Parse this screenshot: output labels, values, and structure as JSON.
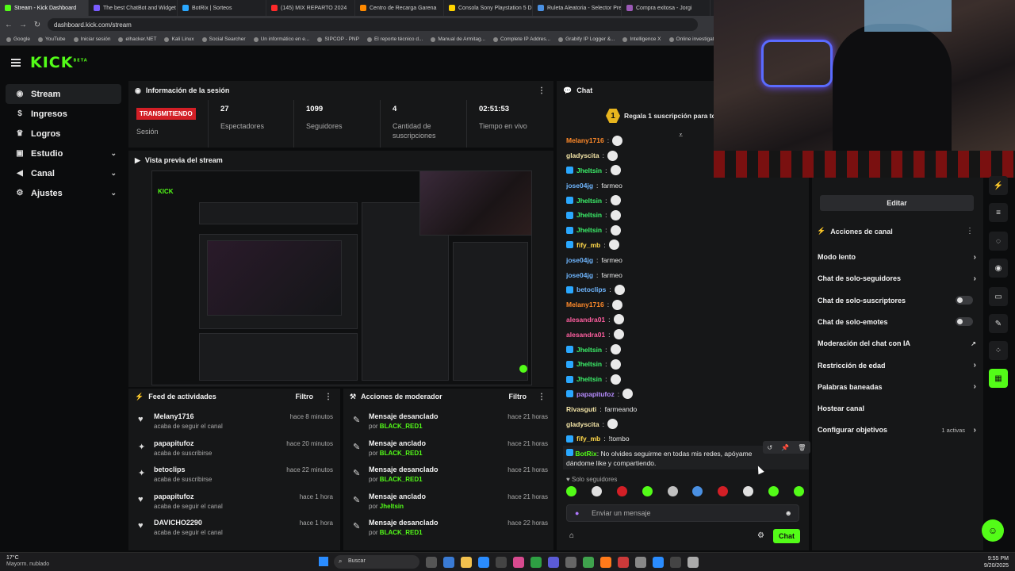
{
  "browser": {
    "tabs": [
      {
        "label": "Stream - Kick Dashboard",
        "color": "#53fc18",
        "active": true
      },
      {
        "label": "The best ChatBot and Widget",
        "color": "#7a5cff"
      },
      {
        "label": "BotRix | Sorteos",
        "color": "#2aa8ff"
      },
      {
        "label": "(145) MIX REPARTO 2024",
        "color": "#ff2a2a"
      },
      {
        "label": "Centro de Recarga Garena",
        "color": "#ff8a00"
      },
      {
        "label": "Consola Sony Playstation 5 D",
        "color": "#ffd400"
      },
      {
        "label": "Ruleta Aleatoria - Selector Pre",
        "color": "#4a90e2"
      },
      {
        "label": "Compra exitosa - Jorgi",
        "color": "#9b59b6"
      }
    ],
    "url": "dashboard.kick.com/stream",
    "bookmarks": [
      "Google",
      "YouTube",
      "Iniciar sesión",
      "elhacker.NET",
      "Kali Linux",
      "Social Searcher",
      "Un informático en e...",
      "SIPCOP - PNP",
      "El reporte técnico d...",
      "Manual de Armitag...",
      "Complete IP Addres...",
      "Grabify IP Logger &...",
      "Intelligence X",
      "Online investigation..."
    ]
  },
  "brand": {
    "logo": "KICK",
    "beta": "BETA",
    "accent": "#53fc18"
  },
  "sidebar": {
    "items": [
      {
        "label": "Stream",
        "icon": "broadcast-icon",
        "active": true
      },
      {
        "label": "Ingresos",
        "icon": "money-icon"
      },
      {
        "label": "Logros",
        "icon": "trophy-icon"
      },
      {
        "label": "Estudio",
        "icon": "video-icon",
        "chevron": true
      },
      {
        "label": "Canal",
        "icon": "megaphone-icon",
        "chevron": true
      },
      {
        "label": "Ajustes",
        "icon": "gear-icon",
        "chevron": true
      }
    ]
  },
  "session": {
    "title": "Información de la sesión",
    "status": "TRANSMITIENDO",
    "status_label": "Sesión",
    "stats": [
      {
        "value": "27",
        "label": "Espectadores"
      },
      {
        "value": "1099",
        "label": "Seguidores"
      },
      {
        "value": "4",
        "label": "Cantidad de suscripciones"
      },
      {
        "value": "02:51:53",
        "label": "Tiempo en vivo"
      }
    ]
  },
  "preview": {
    "title": "Vista previa del stream"
  },
  "feed": {
    "title": "Feed de actividades",
    "filter": "Filtro",
    "rows": [
      {
        "user": "Melany1716",
        "action": "acaba de seguir el canal",
        "time": "hace 8 minutos",
        "icon": "heart-icon"
      },
      {
        "user": "papapitufoz",
        "action": "acaba de suscribirse",
        "time": "hace 20 minutos",
        "icon": "star-icon"
      },
      {
        "user": "betoclips",
        "action": "acaba de suscribirse",
        "time": "hace 22 minutos",
        "icon": "star-icon"
      },
      {
        "user": "papapitufoz",
        "action": "acaba de seguir el canal",
        "time": "hace 1 hora",
        "icon": "heart-icon"
      },
      {
        "user": "DAVICHO2290",
        "action": "acaba de seguir el canal",
        "time": "hace 1 hora",
        "icon": "heart-icon"
      }
    ]
  },
  "mod": {
    "title": "Acciones de moderador",
    "filter": "Filtro",
    "by": "por",
    "rows": [
      {
        "action": "Mensaje desanclado",
        "by": "BLACK_RED1",
        "time": "hace 21 horas"
      },
      {
        "action": "Mensaje anclado",
        "by": "BLACK_RED1",
        "time": "hace 21 horas"
      },
      {
        "action": "Mensaje desanclado",
        "by": "BLACK_RED1",
        "time": "hace 21 horas"
      },
      {
        "action": "Mensaje anclado",
        "by": "Jheltsin",
        "time": "hace 21 horas"
      },
      {
        "action": "Mensaje desanclado",
        "by": "BLACK_RED1",
        "time": "hace 22 horas"
      }
    ]
  },
  "chat": {
    "title": "Chat",
    "gift_banner": "Regala 1 suscripción para tor",
    "gift_count": "1",
    "messages": [
      {
        "user": "Melany1716",
        "color": "#ff8a2a",
        "text": "",
        "emote": true
      },
      {
        "user": "gladyscita",
        "color": "#f5e6a8",
        "text": "",
        "emote": true
      },
      {
        "user": "Jheltsin",
        "color": "#3cf06a",
        "text": "",
        "emote": true,
        "badge": true
      },
      {
        "user": "jose04jg",
        "color": "#6fb6ff",
        "text": "farmeo"
      },
      {
        "user": "Jheltsin",
        "color": "#3cf06a",
        "text": "",
        "emote": true,
        "badge": true
      },
      {
        "user": "Jheltsin",
        "color": "#3cf06a",
        "text": "",
        "emote": true,
        "badge": true
      },
      {
        "user": "Jheltsin",
        "color": "#3cf06a",
        "text": "",
        "emote": true,
        "badge": true
      },
      {
        "user": "fify_mb",
        "color": "#ffd84a",
        "text": "",
        "emote": true,
        "badge": true
      },
      {
        "user": "jose04jg",
        "color": "#6fb6ff",
        "text": "farmeo"
      },
      {
        "user": "jose04jg",
        "color": "#6fb6ff",
        "text": "farmeo"
      },
      {
        "user": "betoclips",
        "color": "#6fb6ff",
        "text": "",
        "emote": true,
        "badge": true
      },
      {
        "user": "Melany1716",
        "color": "#ff8a2a",
        "text": "",
        "emote": true
      },
      {
        "user": "alesandra01",
        "color": "#ff5fa0",
        "text": "",
        "emote": true
      },
      {
        "user": "alesandra01",
        "color": "#ff5fa0",
        "text": "",
        "emote": true
      },
      {
        "user": "Jheltsin",
        "color": "#3cf06a",
        "text": "",
        "emote": true,
        "badge": true
      },
      {
        "user": "Jheltsin",
        "color": "#3cf06a",
        "text": "",
        "emote": true,
        "badge": true
      },
      {
        "user": "Jheltsin",
        "color": "#3cf06a",
        "text": "",
        "emote": true,
        "badge": true
      },
      {
        "user": "papapitufoz",
        "color": "#b78cff",
        "text": "",
        "emote": true,
        "badge": true
      },
      {
        "user": "Rivasguti",
        "color": "#f5e6a8",
        "text": "farmeando"
      },
      {
        "user": "gladyscita",
        "color": "#f5e6a8",
        "text": "",
        "emote": true
      },
      {
        "user": "fify_mb",
        "color": "#ffd84a",
        "text": "!tombo",
        "badge": true
      }
    ],
    "bot": {
      "user": "BotRix",
      "text": "No olvides seguirme en todas mis redes, apóyame dándome like y compartiendo."
    },
    "mode_label": "Solo seguidores",
    "input_placeholder": "Enviar un mensaje",
    "send": "Chat"
  },
  "channel_actions": {
    "edit": "Editar",
    "title": "Acciones de canal",
    "items": [
      {
        "label": "Modo lento",
        "type": "chevron"
      },
      {
        "label": "Chat de solo-seguidores",
        "type": "chevron"
      },
      {
        "label": "Chat de solo-suscriptores",
        "type": "toggle"
      },
      {
        "label": "Chat de solo-emotes",
        "type": "toggle"
      },
      {
        "label": "Moderación del chat con IA",
        "type": "external"
      },
      {
        "label": "Restricción de edad",
        "type": "chevron"
      },
      {
        "label": "Palabras baneadas",
        "type": "chevron"
      },
      {
        "label": "Hostear canal",
        "type": "none"
      },
      {
        "label": "Configurar objetivos",
        "type": "chevron",
        "extra": "1 activas"
      }
    ]
  },
  "taskbar": {
    "temp": "17°C",
    "weather": "Mayorm. nublado",
    "search": "Buscar",
    "time": "9:55 PM",
    "date": "9/20/2025"
  }
}
